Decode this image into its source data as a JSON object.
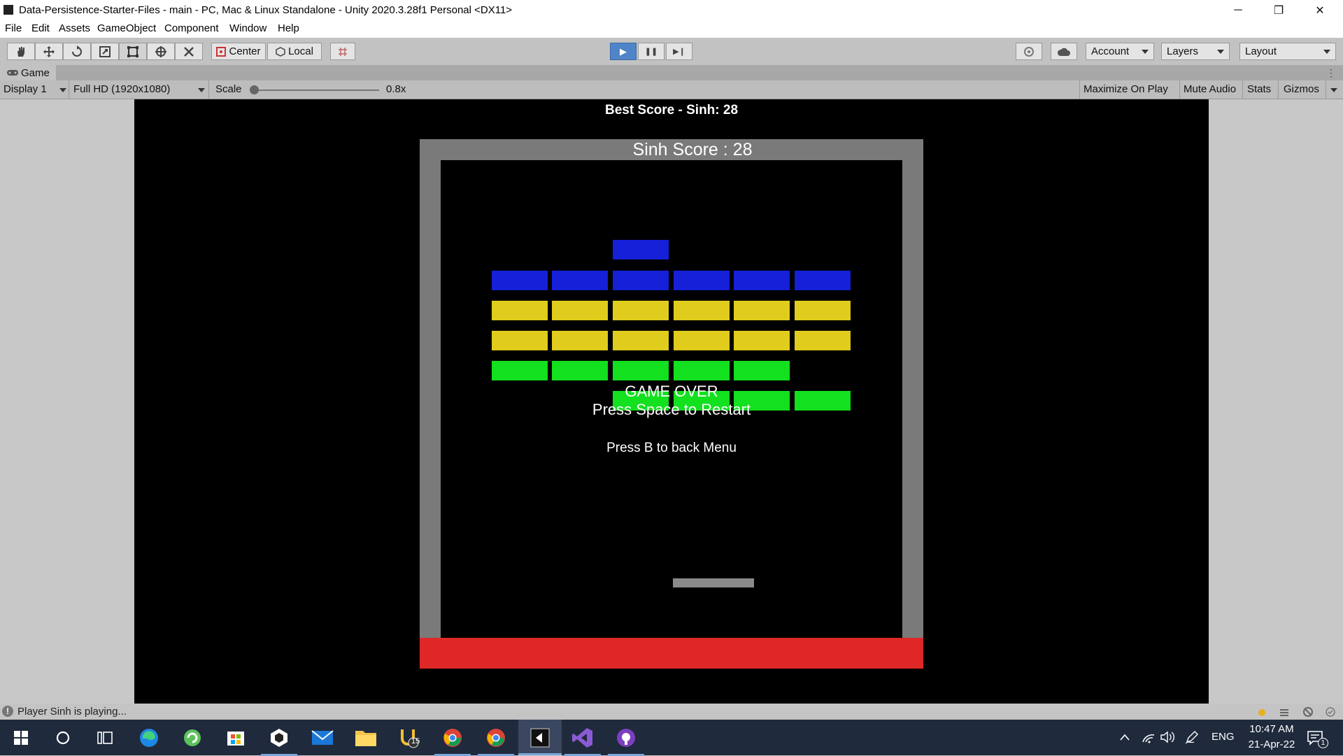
{
  "window": {
    "title": "Data-Persistence-Starter-Files - main - PC, Mac & Linux Standalone - Unity 2020.3.28f1 Personal <DX11>",
    "minimize_symbol": "─",
    "maximize_symbol": "❐",
    "close_symbol": "✕"
  },
  "menu": [
    "File",
    "Edit",
    "Assets",
    "GameObject",
    "Component",
    "Window",
    "Help"
  ],
  "toolbar": {
    "tools": [
      "hand-tool-icon",
      "move-tool-icon",
      "rotate-tool-icon",
      "scale-tool-icon",
      "rect-tool-icon",
      "transform-tool-icon",
      "custom-tool-icon"
    ],
    "pivot_label": "Center",
    "space_label": "Local",
    "play_symbol": "▶",
    "pause_symbol": "❚❚",
    "step_symbol": "▶❙",
    "account_label": "Account",
    "layers_label": "Layers",
    "layout_label": "Layout"
  },
  "game_tab": {
    "label": "Game",
    "display": "Display 1",
    "resolution": "Full HD (1920x1080)",
    "scale_label": "Scale",
    "scale_value": "0.8x",
    "scale_fraction": 0.0,
    "maximize_on_play": "Maximize On Play",
    "mute_audio": "Mute Audio",
    "stats": "Stats",
    "gizmos": "Gizmos"
  },
  "game": {
    "best_score": "Best Score - Sinh: 28",
    "score": "Sinh Score : 28",
    "game_over": "GAME OVER",
    "restart": "Press Space to Restart",
    "back_menu": "Press B to back Menu",
    "colors": {
      "blue": "#1520d8",
      "yellow": "#e0cc1c",
      "green": "#13e01f",
      "wall": "#7a7a7a",
      "floor": "#e02727",
      "paddle": "#8a8a8a"
    }
  },
  "status": {
    "message": "Player Sinh is playing..."
  },
  "taskbar": {
    "lang": "ENG",
    "time": "10:47 AM",
    "date": "21-Apr-22",
    "badge_count": "15",
    "notif_count": "1"
  }
}
